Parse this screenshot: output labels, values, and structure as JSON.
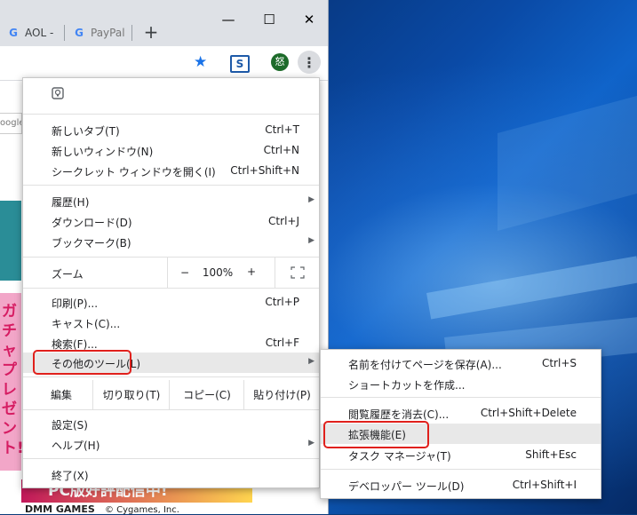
{
  "browser": {
    "tabs": [
      {
        "label": "AOL -"
      },
      {
        "label": "PayPal"
      }
    ],
    "new_tab_symbol": "+",
    "window_controls": {
      "minimize": "—",
      "maximize": "☐",
      "close": "✕"
    },
    "ext_label": "S",
    "avatar_label": "怒"
  },
  "page": {
    "google_fragment": "oogle",
    "pink_text": "ガチャ プレゼント!",
    "banner_text": "PC版好評配信中!",
    "footer_brand": "DMM GAMES",
    "footer_copy": "© Cygames, Inc."
  },
  "menu": {
    "items_group1": [
      {
        "label": "新しいタブ(T)",
        "shortcut": "Ctrl+T"
      },
      {
        "label": "新しいウィンドウ(N)",
        "shortcut": "Ctrl+N"
      },
      {
        "label": "シークレット ウィンドウを開く(I)",
        "shortcut": "Ctrl+Shift+N"
      }
    ],
    "items_group2": [
      {
        "label": "履歴(H)",
        "shortcut": ""
      },
      {
        "label": "ダウンロード(D)",
        "shortcut": "Ctrl+J"
      },
      {
        "label": "ブックマーク(B)",
        "shortcut": ""
      }
    ],
    "zoom": {
      "label": "ズーム",
      "minus": "−",
      "value": "100%",
      "plus": "+",
      "fullscreen": "⛶"
    },
    "items_group3": [
      {
        "label": "印刷(P)...",
        "shortcut": "Ctrl+P"
      },
      {
        "label": "キャスト(C)...",
        "shortcut": ""
      },
      {
        "label": "検索(F)...",
        "shortcut": "Ctrl+F"
      },
      {
        "label": "その他のツール(L)",
        "shortcut": ""
      }
    ],
    "edit": {
      "label": "編集",
      "cut": "切り取り(T)",
      "copy": "コピー(C)",
      "paste": "貼り付け(P)"
    },
    "items_group4": [
      {
        "label": "設定(S)"
      },
      {
        "label": "ヘルプ(H)"
      }
    ],
    "exit": {
      "label": "終了(X)"
    }
  },
  "submenu": {
    "items_group1": [
      {
        "label": "名前を付けてページを保存(A)...",
        "shortcut": "Ctrl+S"
      },
      {
        "label": "ショートカットを作成...",
        "shortcut": ""
      }
    ],
    "items_group2": [
      {
        "label": "閲覧履歴を消去(C)...",
        "shortcut": "Ctrl+Shift+Delete"
      },
      {
        "label": "拡張機能(E)",
        "shortcut": ""
      },
      {
        "label": "タスク マネージャ(T)",
        "shortcut": "Shift+Esc"
      }
    ],
    "items_group3": [
      {
        "label": "デベロッパー ツール(D)",
        "shortcut": "Ctrl+Shift+I"
      }
    ]
  }
}
